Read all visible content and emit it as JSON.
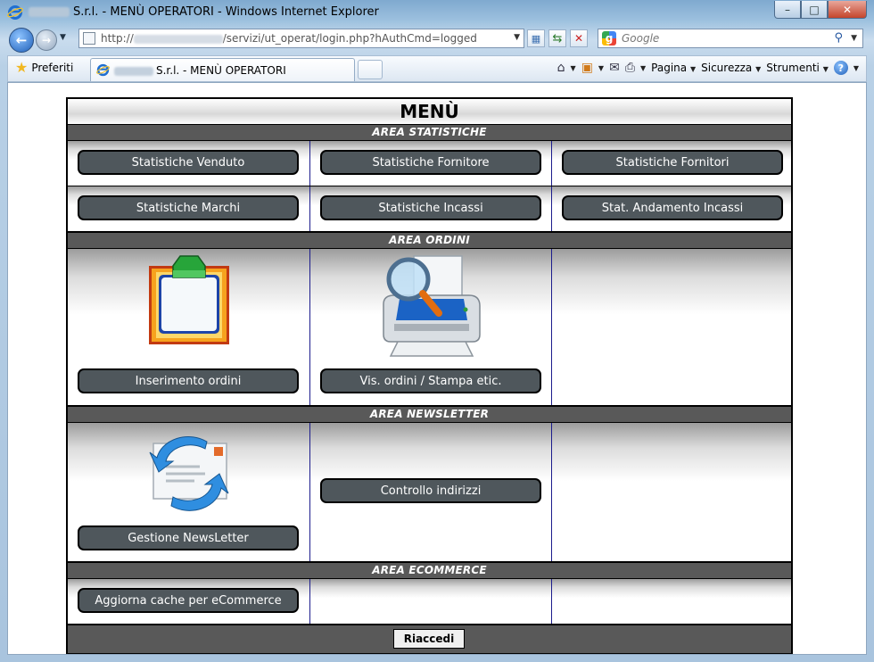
{
  "window": {
    "title": "S.r.l. - MENÙ OPERATORI - Windows Internet Explorer",
    "minimize": "–",
    "maximize": "□",
    "close": "✕"
  },
  "address_bar": {
    "url_prefix": "http://",
    "url_path": "/servizi/ut_operat/login.php?hAuthCmd=logged"
  },
  "search": {
    "placeholder": "Google"
  },
  "favorites": {
    "label": "Preferiti"
  },
  "tab": {
    "title": "S.r.l. - MENÙ OPERATORI"
  },
  "toolbar": {
    "pagina": "Pagina",
    "sicurezza": "Sicurezza",
    "strumenti": "Strumenti"
  },
  "menu": {
    "title": "MENÙ",
    "sections": {
      "statistiche": "AREA STATISTICHE",
      "ordini": "AREA ORDINI",
      "newsletter": "AREA NEWSLETTER",
      "ecommerce": "AREA ECOMMERCE"
    },
    "buttons": {
      "stat_venduto": "Statistiche Venduto",
      "stat_fornitore": "Statistiche Fornitore",
      "stat_fornitori": "Statistiche Fornitori",
      "stat_marchi": "Statistiche Marchi",
      "stat_incassi": "Statistiche Incassi",
      "stat_andamento": "Stat. Andamento Incassi",
      "inserimento_ordini": "Inserimento ordini",
      "vis_ordini": "Vis. ordini / Stampa etic.",
      "gestione_newsletter": "Gestione NewsLetter",
      "controllo_indirizzi": "Controllo indirizzi",
      "aggiorna_cache": "Aggiorna cache per eCommerce"
    },
    "footer_button": "Riaccedi"
  },
  "colors": {
    "section_bar": "#595959",
    "button_bg": "#4f575c",
    "cell_divider": "#1c1c8c"
  }
}
